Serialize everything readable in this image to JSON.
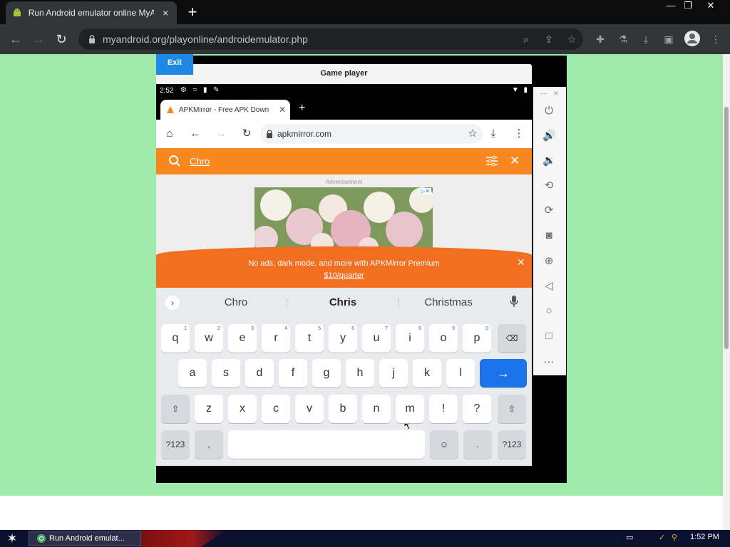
{
  "browser": {
    "tab_title": "Run Android emulator online MyAndroid",
    "tab_close": "×",
    "new_tab": "+",
    "url": "myandroid.org/playonline/androidemulator.php",
    "window_controls": {
      "minimize": "—",
      "restore": "❐",
      "close": "✕"
    }
  },
  "page": {
    "exit_label": "Exit",
    "player_title": "Game player"
  },
  "android": {
    "status_time": "2:52",
    "tab_title": "APKMirror - Free APK Down",
    "tab_close": "✕",
    "new_tab": "+",
    "url": "apkmirror.com",
    "search_query": "Chro",
    "ad_label": "Advertisement",
    "promo_text": "No ads, dark mode, and more with APKMirror Premium",
    "promo_link": "$10/quarter",
    "promo_close": "✕",
    "suggestions": [
      "Chro",
      "Chris",
      "Christmas"
    ],
    "keys_row1": [
      {
        "k": "q",
        "h": "1"
      },
      {
        "k": "w",
        "h": "2"
      },
      {
        "k": "e",
        "h": "3"
      },
      {
        "k": "r",
        "h": "4"
      },
      {
        "k": "t",
        "h": "5"
      },
      {
        "k": "y",
        "h": "6"
      },
      {
        "k": "u",
        "h": "7"
      },
      {
        "k": "i",
        "h": "8"
      },
      {
        "k": "o",
        "h": "9"
      },
      {
        "k": "p",
        "h": "0"
      }
    ],
    "keys_row2": [
      "a",
      "s",
      "d",
      "f",
      "g",
      "h",
      "j",
      "k",
      "l"
    ],
    "keys_row3": [
      "z",
      "x",
      "c",
      "v",
      "b",
      "n",
      "m",
      "!",
      "?"
    ],
    "key_symbols": "?123",
    "key_comma": ",",
    "key_period": ".",
    "key_enter": "→"
  },
  "taskbar": {
    "item_label": "Run Android emulat...",
    "clock": "1:52 PM"
  },
  "colors": {
    "page_bg": "#9feaa9",
    "apk_orange": "#f7871e",
    "enter_blue": "#1a73e8",
    "exit_blue": "#1e88e5"
  }
}
